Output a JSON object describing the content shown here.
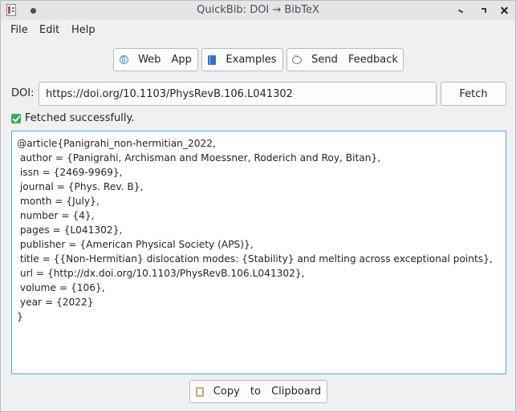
{
  "window": {
    "title": "QuickBib: DOI → BibTeX"
  },
  "menu": {
    "file": "File",
    "edit": "Edit",
    "help": "Help"
  },
  "toolbar": {
    "web_app": "Web App",
    "examples": "Examples",
    "send_feedback": "Send Feedback"
  },
  "doi": {
    "label": "DOI:",
    "value": "https://doi.org/10.1103/PhysRevB.106.L041302",
    "fetch_label": "Fetch"
  },
  "status": {
    "text": "Fetched successfully.",
    "color": "#3dae4f"
  },
  "output": {
    "bibtex": "@article{Panigrahi_non-hermitian_2022,\n author = {Panigrahi, Archisman and Moessner, Roderich and Roy, Bitan},\n issn = {2469-9969},\n journal = {Phys. Rev. B},\n month = {July},\n number = {4},\n pages = {L041302},\n publisher = {American Physical Society (APS)},\n title = {{Non-Hermitian} dislocation modes: {Stability} and melting across exceptional points},\n url = {http://dx.doi.org/10.1103/PhysRevB.106.L041302},\n volume = {106},\n year = {2022}\n}"
  },
  "actions": {
    "copy_label": "Copy to Clipboard"
  },
  "icons": {
    "web_app": "globe-icon",
    "examples": "book-icon",
    "send_feedback": "speech-bubble-icon",
    "copy": "clipboard-icon",
    "status": "check-mark-icon"
  },
  "colors": {
    "focus_border": "#3daee9",
    "window_bg": "#eff0f1"
  }
}
